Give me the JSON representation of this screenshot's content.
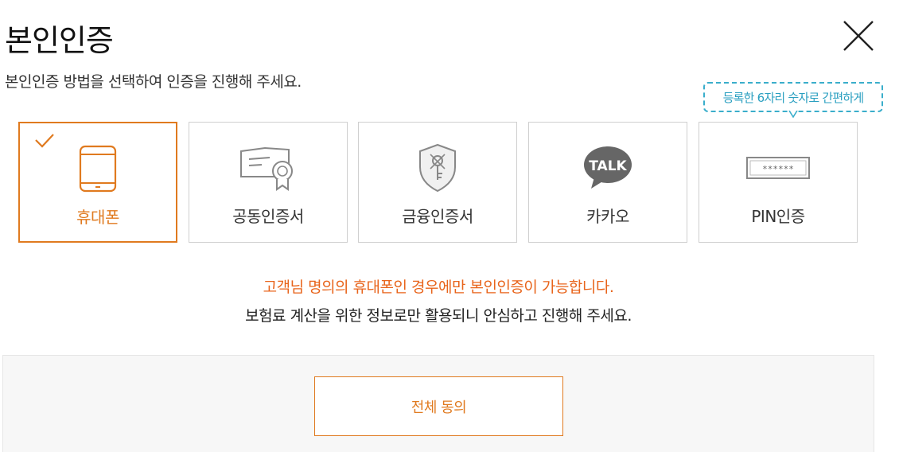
{
  "header": {
    "title": "본인인증",
    "subtitle": "본인인증 방법을 선택하여 인증을 진행해 주세요."
  },
  "tooltip": {
    "text": "등록한 6자리 숫자로 간편하게"
  },
  "methods": [
    {
      "label": "휴대폰",
      "icon": "mobile-phone-icon",
      "selected": true
    },
    {
      "label": "공동인증서",
      "icon": "certificate-icon",
      "selected": false
    },
    {
      "label": "금융인증서",
      "icon": "shield-key-icon",
      "selected": false
    },
    {
      "label": "카카오",
      "icon": "kakao-talk-icon",
      "selected": false,
      "icon_text": "TALK"
    },
    {
      "label": "PIN인증",
      "icon": "pin-code-icon",
      "selected": false,
      "icon_text": "******"
    }
  ],
  "notices": {
    "line1": "고객님 명의의 휴대폰인 경우에만 본인인증이 가능합니다.",
    "line2": "보험료 계산을 위한 정보로만 활용되니 안심하고 진행해 주세요."
  },
  "agreement": {
    "button_label": "전체 동의"
  },
  "colors": {
    "accent": "#e07a1f",
    "notice": "#e8641b",
    "tooltip": "#3aaecb",
    "border": "#cfcfcf",
    "panel_bg": "#f7f7f7"
  }
}
